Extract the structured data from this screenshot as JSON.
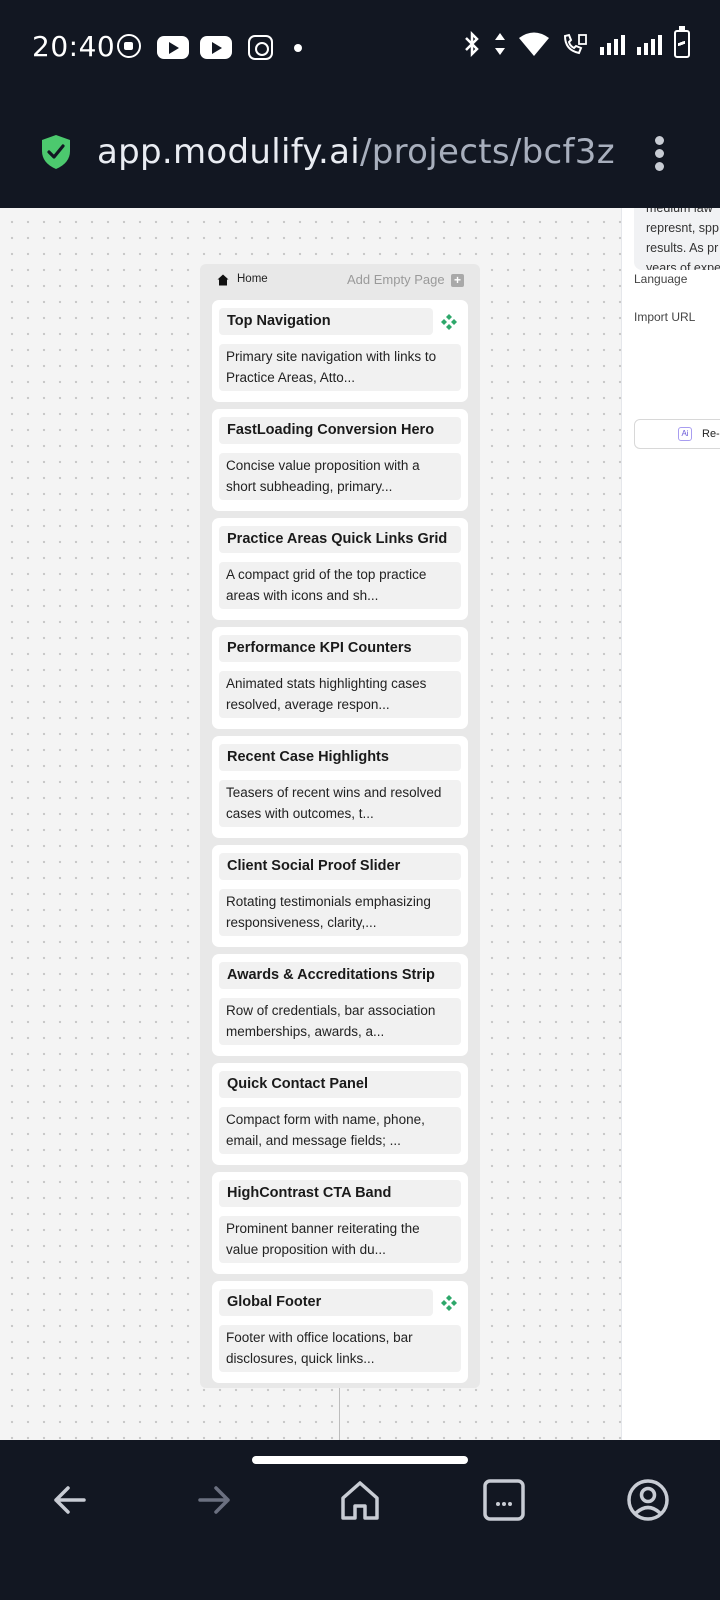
{
  "status_bar": {
    "time": "20:40"
  },
  "browser": {
    "url_host": "app.modulify.ai",
    "url_path": "/projects/bcf3z"
  },
  "right_panel": {
    "text_lines": [
      "medium law",
      "represnt, spp",
      "results. As pr",
      "years of expe"
    ],
    "language_label": "Language",
    "import_url_label": "Import URL",
    "regenerate_label": "Re-"
  },
  "page": {
    "home_label": "Home",
    "add_empty_page": "Add Empty Page",
    "sections": [
      {
        "title": "Top Navigation",
        "description": "Primary site navigation with links to Practice Areas, Atto...",
        "global": true
      },
      {
        "title": "FastLoading Conversion Hero",
        "description": "Concise value proposition with a short subheading, primary...",
        "global": false
      },
      {
        "title": "Practice Areas Quick Links Grid",
        "description": "A compact grid of the top practice areas with icons and sh...",
        "global": false
      },
      {
        "title": "Performance KPI Counters",
        "description": "Animated stats highlighting cases resolved, average respon...",
        "global": false
      },
      {
        "title": "Recent Case Highlights",
        "description": "Teasers of recent wins and resolved cases with outcomes, t...",
        "global": false
      },
      {
        "title": "Client Social Proof Slider",
        "description": "Rotating testimonials emphasizing responsiveness, clarity,...",
        "global": false
      },
      {
        "title": "Awards & Accreditations Strip",
        "description": "Row of credentials, bar association memberships, awards, a...",
        "global": false
      },
      {
        "title": "Quick Contact Panel",
        "description": "Compact form with name, phone, email, and message fields; ...",
        "global": false
      },
      {
        "title": "HighContrast CTA Band",
        "description": "Prominent banner reiterating the value proposition with du...",
        "global": false
      },
      {
        "title": "Global Footer",
        "description": "Footer with office locations, bar disclosures, quick links...",
        "global": true
      }
    ]
  },
  "colors": {
    "chrome_bg": "#121722",
    "shield_green": "#4cc96e",
    "component_green": "#2ea86b"
  }
}
